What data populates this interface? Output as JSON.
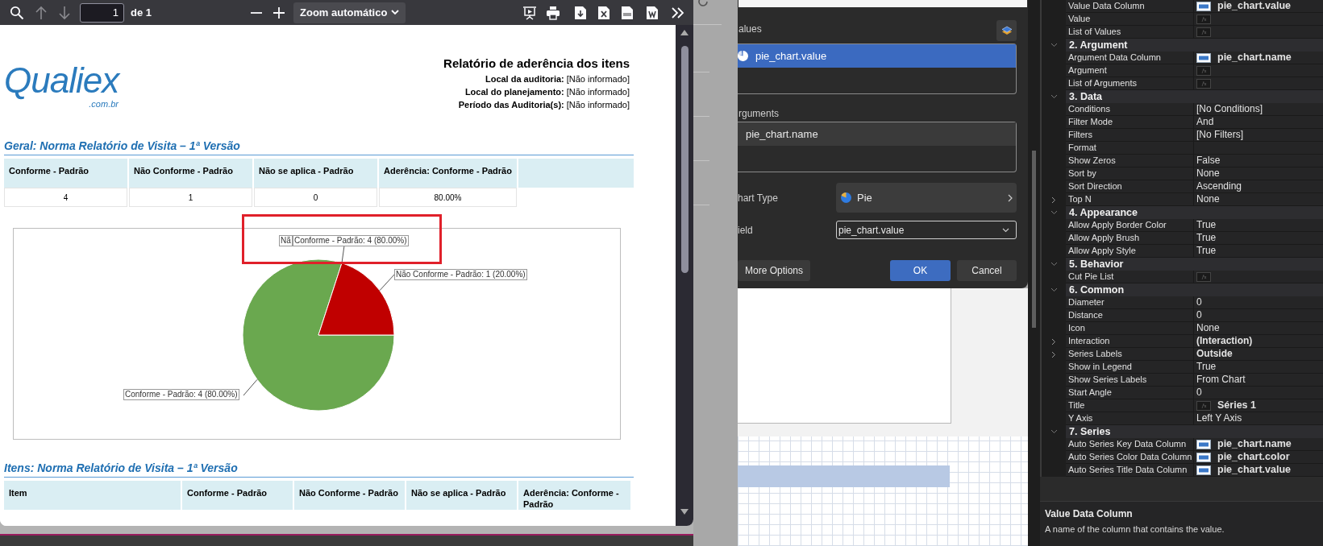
{
  "pdf_viewer": {
    "toolbar": {
      "page_number": "1",
      "page_count": "de 1",
      "zoom": "Zoom automático"
    },
    "report": {
      "logo": {
        "name": "Qualiex",
        "domain": ".com.br"
      },
      "title": "Relatório de aderência dos itens",
      "info": [
        {
          "label": "Local da auditoria:",
          "value": "[Não informado]"
        },
        {
          "label": "Local do planejamento:",
          "value": "[Não informado]"
        },
        {
          "label": "Período das Auditoria(s):",
          "value": "[Não informado]"
        }
      ],
      "sections": [
        {
          "title": "Geral: Norma Relatório de Visita – 1ª Versão",
          "columns": [
            "Conforme - Padrão",
            "Não Conforme - Padrão",
            "Não se aplica - Padrão",
            "Aderência: Conforme - Padrão"
          ],
          "rows": [
            [
              "4",
              "1",
              "0",
              "80.00%"
            ]
          ],
          "chart": {
            "chart_data": {
              "type": "pie",
              "values": [
                4,
                1
              ],
              "colors": [
                "#6aa84f",
                "#c00000"
              ],
              "value_labels": [
                "Conforme - Padrão: 4 (80.00%)",
                "Não Conforme - Padrão: 1 (20.00%)"
              ]
            },
            "overlapping_labels": [
              "Nã",
              "Conforme - Padrão: 4 (80.00%)"
            ]
          }
        },
        {
          "title": "Itens: Norma Relatório de Visita – 1ª Versão",
          "columns": [
            "Item",
            "Conforme - Padrão",
            "Não Conforme - Padrão",
            "Não se aplica - Padrão",
            "Aderência: Conforme - Padrão"
          ]
        }
      ]
    }
  },
  "chart_dialog": {
    "values_label": "alues",
    "values": {
      "focused": true,
      "items": [
        {
          "text": "pie_chart.value",
          "selected": true
        }
      ]
    },
    "arguments_label": "rguments",
    "arguments": {
      "focused": false,
      "items": [
        {
          "text": "pie_chart.name",
          "selected": true
        }
      ]
    },
    "chart_type_label": "hart Type",
    "chart_type": "Pie",
    "field_label": "ield",
    "field": "pie_chart.value",
    "buttons": [
      {
        "label": "More Options",
        "kind": "secondary"
      },
      {
        "label": "OK",
        "kind": "primary"
      },
      {
        "label": "Cancel",
        "kind": "secondary"
      }
    ]
  },
  "properties": {
    "rows": [
      {
        "kind": "property",
        "name": "Value Data Column",
        "value": {
          "kind": "column",
          "text": "pie_chart.value"
        }
      },
      {
        "kind": "property",
        "name": "Value",
        "value": {
          "kind": "fx"
        }
      },
      {
        "kind": "property",
        "name": "List of Values",
        "value": {
          "kind": "fx"
        }
      },
      {
        "kind": "section",
        "label": "2. Argument",
        "expanded": true
      },
      {
        "kind": "property",
        "name": "Argument Data Column",
        "value": {
          "kind": "column",
          "text": "pie_chart.name"
        }
      },
      {
        "kind": "property",
        "name": "Argument",
        "value": {
          "kind": "fx"
        }
      },
      {
        "kind": "property",
        "name": "List of Arguments",
        "value": {
          "kind": "fx"
        }
      },
      {
        "kind": "section",
        "label": "3. Data",
        "expanded": true
      },
      {
        "kind": "property",
        "name": "Conditions",
        "value": {
          "kind": "text",
          "text": "[No Conditions]"
        }
      },
      {
        "kind": "property",
        "name": "Filter Mode",
        "value": {
          "kind": "text",
          "text": "And"
        }
      },
      {
        "kind": "property",
        "name": "Filters",
        "value": {
          "kind": "text",
          "text": "[No Filters]"
        }
      },
      {
        "kind": "property",
        "name": "Format"
      },
      {
        "kind": "property",
        "name": "Show Zeros",
        "value": {
          "kind": "text",
          "text": "False"
        }
      },
      {
        "kind": "property",
        "name": "Sort by",
        "value": {
          "kind": "text",
          "text": "None"
        }
      },
      {
        "kind": "property",
        "name": "Sort Direction",
        "value": {
          "kind": "text",
          "text": "Ascending"
        }
      },
      {
        "kind": "property",
        "name": "Top N",
        "value": {
          "kind": "text",
          "text": "None"
        },
        "expanded": false
      },
      {
        "kind": "section",
        "label": "4. Appearance",
        "expanded": true
      },
      {
        "kind": "property",
        "name": "Allow Apply Border Color",
        "value": {
          "kind": "text",
          "text": "True"
        }
      },
      {
        "kind": "property",
        "name": "Allow Apply Brush",
        "value": {
          "kind": "text",
          "text": "True"
        }
      },
      {
        "kind": "property",
        "name": "Allow Apply Style",
        "value": {
          "kind": "text",
          "text": "True"
        }
      },
      {
        "kind": "section",
        "label": "5. Behavior",
        "expanded": true
      },
      {
        "kind": "property",
        "name": "Cut Pie List",
        "value": {
          "kind": "fx"
        }
      },
      {
        "kind": "section",
        "label": "6. Common",
        "expanded": true
      },
      {
        "kind": "property",
        "name": "Diameter",
        "value": {
          "kind": "text",
          "text": "0"
        }
      },
      {
        "kind": "property",
        "name": "Distance",
        "value": {
          "kind": "text",
          "text": "0"
        }
      },
      {
        "kind": "property",
        "name": "Icon",
        "value": {
          "kind": "text",
          "text": "None"
        }
      },
      {
        "kind": "property",
        "name": "Interaction",
        "value": {
          "kind": "bold",
          "text": "(Interaction)"
        },
        "expanded": false
      },
      {
        "kind": "property",
        "name": "Series Labels",
        "value": {
          "kind": "bold",
          "text": "Outside"
        },
        "expanded": false
      },
      {
        "kind": "property",
        "name": "Show in Legend",
        "value": {
          "kind": "text",
          "text": "True"
        }
      },
      {
        "kind": "property",
        "name": "Show Series Labels",
        "value": {
          "kind": "text",
          "text": "From Chart"
        }
      },
      {
        "kind": "property",
        "name": "Start Angle",
        "value": {
          "kind": "text",
          "text": "0"
        }
      },
      {
        "kind": "property",
        "name": "Title",
        "value": {
          "kind": "fx",
          "text": "Séries 1"
        }
      },
      {
        "kind": "property",
        "name": "Y Axis",
        "value": {
          "kind": "text",
          "text": "Left Y Axis"
        }
      },
      {
        "kind": "section",
        "label": "7. Series",
        "expanded": true
      },
      {
        "kind": "property",
        "name": "Auto Series Key Data Column",
        "value": {
          "kind": "column",
          "text": "pie_chart.name"
        }
      },
      {
        "kind": "property",
        "name": "Auto Series Color Data Column",
        "value": {
          "kind": "column",
          "text": "pie_chart.color"
        }
      },
      {
        "kind": "property",
        "name": "Auto Series Title Data Column",
        "value": {
          "kind": "column",
          "text": "pie_chart.value"
        }
      }
    ],
    "description": {
      "title": "Value Data Column",
      "text": "A name of the column that contains the value."
    }
  }
}
